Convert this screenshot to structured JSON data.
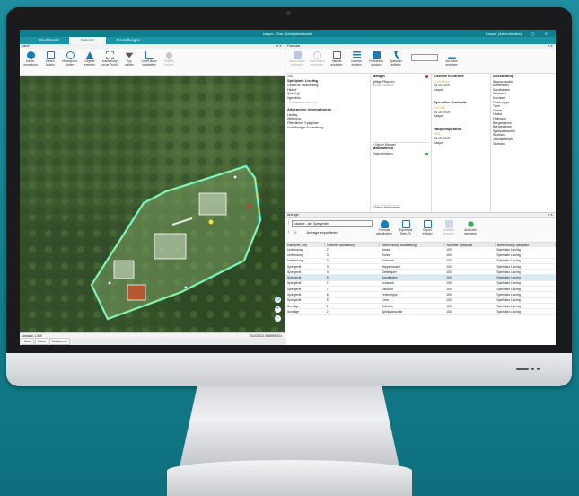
{
  "app": {
    "title": "kasper - Das Spielplatzkataster",
    "user": "Kasper (Administrator)",
    "window_controls": "– ▢ ✕"
  },
  "tabs": [
    {
      "label": "Dashboard"
    },
    {
      "label": "Kataster"
    },
    {
      "label": "Einstellungen"
    }
  ],
  "left_panel": {
    "title": "Karte",
    "ribbon": [
      {
        "label": "Karten-\nverwaltung",
        "icon": "gear-icon",
        "color": "#1a7bb8"
      },
      {
        "label": "Karten\nändern",
        "icon": "layers-icon",
        "color": "#1a7bb8"
      },
      {
        "label": "Hintergrund-\nkarten",
        "icon": "globe-icon",
        "color": "#1a7bb8"
      },
      {
        "label": "Objekte\nerstellen",
        "icon": "shapes-icon",
        "color": "#1a7bb8"
      },
      {
        "label": "Ausstattung\nneuer Punkt",
        "icon": "add-point-icon",
        "color": "#4caf50"
      },
      {
        "label": "Typ\nwählen",
        "icon": "dropdown-icon",
        "color": "#555"
      },
      {
        "label": "Linie/Fläche\nbearbeiten",
        "icon": "edit-line-icon",
        "color": "#1a7bb8"
      },
      {
        "label": "Objekte\nlöschen",
        "icon": "location-icon",
        "color": "#bbb"
      }
    ],
    "map_scale": "Maßstab 1:339",
    "map_coords": "51023512.5668999224",
    "bottom_tabs": [
      "Karte",
      "Fotos",
      "Dokumente"
    ]
  },
  "right_panel": {
    "title": "Formular",
    "ribbon": [
      {
        "label": "Änderungen\nspeichern"
      },
      {
        "label": "Änderungen\nverwerfen"
      },
      {
        "label": "Historie\nanzeigen"
      },
      {
        "label": "Inventar\ndrucken"
      },
      {
        "label": "Prüfbericht\ndrucken"
      },
      {
        "label": "Spielplatz\nanlegen"
      },
      {
        "label": "Auf Karte\nanzeigen"
      }
    ],
    "search_placeholder": "",
    "general": {
      "id": "100",
      "name": "Spielplatz Lischtg",
      "street": "Gewerde Straßenbeg.",
      "city": "Hildorf",
      "district": "Querfegt",
      "unit": "Irgendwo",
      "note": "* Zu Kasten am 08.07.07",
      "info_title": "Allgemeine Informationen",
      "info": [
        "Lischtg",
        "Widmung",
        "Öffentlicher Spielplatz",
        "Vollständiger Ausstattung"
      ]
    },
    "maengel": {
      "title": "Mängel",
      "item": "giftige Pflanzen",
      "sub": "Bereich: Gebüsch",
      "add_label": "+ Neuer Mangel",
      "massn_title": "Maßnahmen",
      "massn_item": "Gras-heinigen",
      "massn_add": "+ Neue Maßnahme"
    },
    "kontrollen": [
      {
        "title": "Visuelle Kontrolle",
        "date": "04.10.2019",
        "status": "12.09.19 dd",
        "who": "Kasper"
      },
      {
        "title": "Operative Kontrolle",
        "date": "04.10.2019",
        "status": "12.07.19",
        "who": "Kasper"
      },
      {
        "title": "Hauptinspektion",
        "date": "04.10.2019",
        "status": "2019",
        "who": "Kasper"
      }
    ],
    "ausstattung": {
      "title": "Ausstattung",
      "items": [
        "Wippschaukel",
        "Kletterspiel",
        "Sandkasten",
        "Schaukel",
        "Karussel",
        "Federwippe",
        "Turm",
        "Hocke",
        "Hocke",
        "Hollmann",
        "Burgangebot",
        "Burgangebot",
        "Spielplatzschild",
        "Sitzbank",
        "Jalousiebeutel",
        "Sitzbank"
      ]
    }
  },
  "bottom_panel": {
    "title": "Anfrage",
    "select_value": "Kataster - alle Spielgeräte",
    "count": "16",
    "export_label": "Anfrage exportieren",
    "ribbon": [
      "Formular\naktualisieren",
      "Export auf\nSpiel-PC",
      "Export\nin Datei",
      "Aufträge\nanzeigen",
      "Auf Karte\nmarkieren"
    ],
    "columns": [
      "Kategorie_Obj",
      "Nummer Ausstattung",
      "Bezeichnung Ausstattung",
      "Nummer Spielplatz",
      "Bezeichnung Spielplatz"
    ],
    "rows": [
      [
        "Umfriedung",
        "2",
        "Hecke",
        "100",
        "Spielplatz Lischtg"
      ],
      [
        "Umfriedung",
        "3",
        "Hocke",
        "100",
        "Spielplatz Lischtg"
      ],
      [
        "Umfriedung",
        "3",
        "Hollmann",
        "100",
        "Spielplatz Lischtg"
      ],
      [
        "Spielgerät",
        "3",
        "Wippschaukel",
        "100",
        "Spielplatz Lischtg"
      ],
      [
        "Spielgerät",
        "4",
        "Kletterspiel",
        "100",
        "Spielplatz Lischtg"
      ],
      [
        "Spielgerät",
        "5",
        "Sandkasten",
        "100",
        "Spielplatz Lischtg"
      ],
      [
        "Spielgerät",
        "7",
        "Schaukel",
        "100",
        "Spielplatz Lischtg"
      ],
      [
        "Spielgerät",
        "7",
        "Karussel",
        "100",
        "Spielplatz Lischtg"
      ],
      [
        "Spielgerät",
        "8",
        "Federwippe",
        "100",
        "Spielplatz Lischtg"
      ],
      [
        "Spielgerät",
        "9",
        "Turm",
        "100",
        "Spielplatz Lischtg"
      ],
      [
        "Sonstige",
        "1",
        "Sitzbank",
        "100",
        "Spielplatz Lischtg"
      ],
      [
        "Sonstige",
        "2",
        "Spielplatzschild",
        "100",
        "Spielplatz Lischtg"
      ]
    ]
  }
}
